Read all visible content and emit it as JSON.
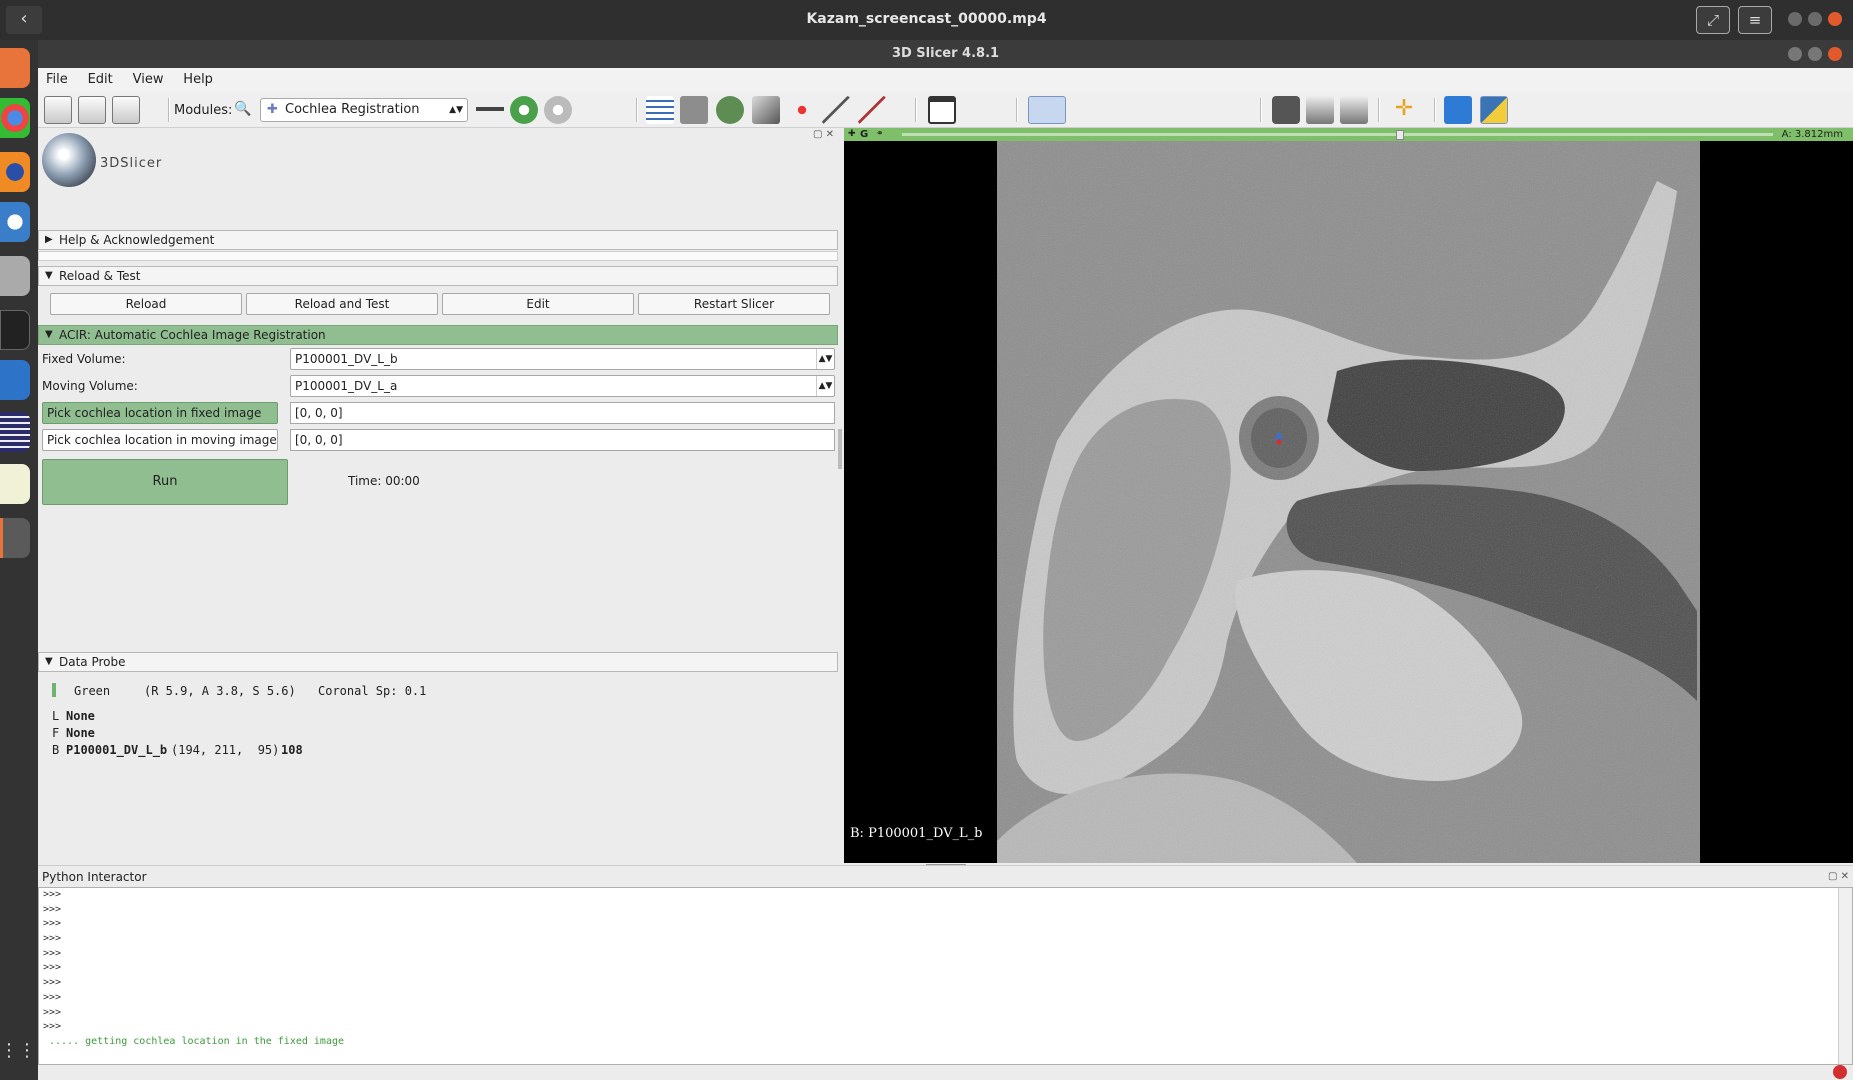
{
  "video": {
    "title": "Kazam_screencast_00000.mp4",
    "back_icon": "‹",
    "fullscreen_icon": "⤢",
    "menu_icon": "≡"
  },
  "window": {
    "title": "3D Slicer 4.8.1"
  },
  "menu": [
    "File",
    "Edit",
    "View",
    "Help"
  ],
  "toolbar": {
    "modules_label": "Modules:",
    "module_selected": "Cochlea Registration"
  },
  "panel": {
    "logo_text": "3DSlicer",
    "sections": {
      "help": "Help & Acknowledgement",
      "reload": "Reload & Test",
      "acir": "ACIR: Automatic Cochlea Image Registration",
      "probe": "Data Probe"
    },
    "reload_buttons": [
      "Reload",
      "Reload and Test",
      "Edit",
      "Restart Slicer"
    ],
    "fixed_label": "Fixed Volume:",
    "fixed_value": "P100001_DV_L_b",
    "moving_label": "Moving Volume:",
    "moving_value": "P100001_DV_L_a",
    "pick_fixed_label": "Pick cochlea location in fixed image",
    "pick_fixed_value": "[0, 0, 0]",
    "pick_moving_label": "Pick cochlea location in moving image",
    "pick_moving_value": "[0, 0, 0]",
    "run_label": "Run",
    "time_label": "Time: 00:00"
  },
  "probe": {
    "view": "Green",
    "coords": "(R 5.9, A 3.8, S 5.6)",
    "orientation": "Coronal Sp: 0.1",
    "L_key": "L",
    "L_val": "None",
    "F_key": "F",
    "F_val": "None",
    "B_key": "B",
    "B_name": "P100001_DV_L_b",
    "B_ijk": "(194, 211,  95)",
    "B_value": "108"
  },
  "slice": {
    "letter": "G",
    "offset": "A: 3.812mm",
    "corner_label": "B: P100001_DV_L_b"
  },
  "python": {
    "title": "Python Interactor",
    "prompts": [
      ">>>",
      ">>>",
      ">>>",
      ">>>",
      ">>>",
      ">>>",
      ">>>",
      ">>>",
      ">>>",
      ">>>"
    ],
    "message": "..... getting cochlea location in the fixed image"
  }
}
